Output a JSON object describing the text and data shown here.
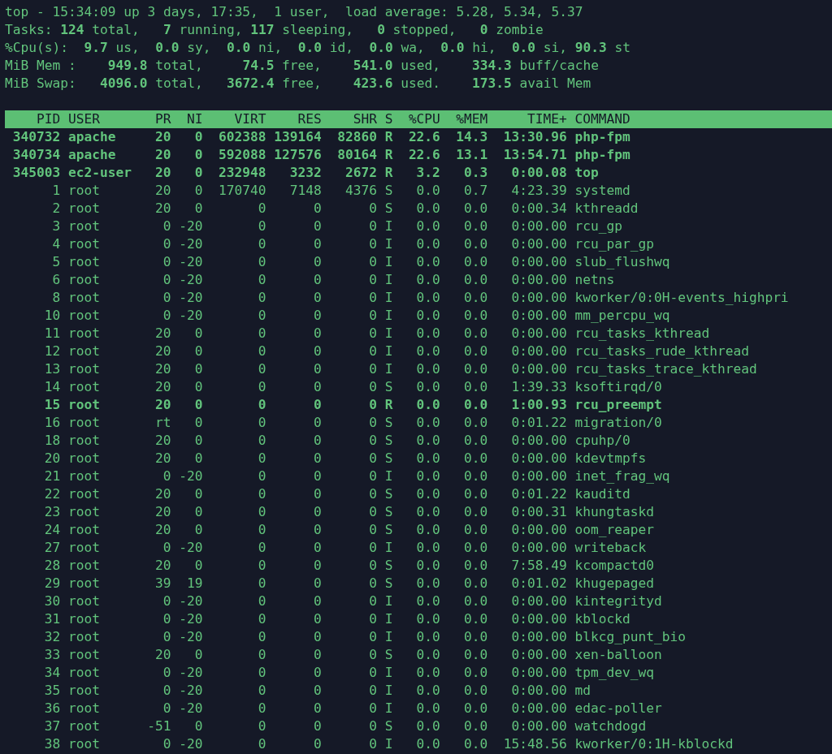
{
  "summary": [
    "top - 15:34:09 up 3 days, 17:35,  1 user,  load average: 5.28, 5.34, 5.37",
    "Tasks: **124** total,   **7** running, **117** sleeping,   **0** stopped,   **0** zombie",
    "%Cpu(s):  **9.7** us,  **0.0** sy,  **0.0** ni,  **0.0** id,  **0.0** wa,  **0.0** hi,  **0.0** si, **90.3** st",
    "MiB Mem :    **949.8** total,     **74.5** free,    **541.0** used,    **334.3** buff/cache",
    "MiB Swap:   **4096.0** total,   **3672.4** free,    **423.6** used.    **173.5** avail Mem"
  ],
  "table": {
    "columns": [
      "PID",
      "USER",
      "PR",
      "NI",
      "VIRT",
      "RES",
      "SHR",
      "S",
      "%CPU",
      "%MEM",
      "TIME+",
      "COMMAND"
    ],
    "rows": [
      {
        "highlighted": true,
        "cells": [
          "340732",
          "apache",
          "20",
          "0",
          "602388",
          "139164",
          "82860",
          "R",
          "22.6",
          "14.3",
          "13:30.96",
          "php-fpm"
        ]
      },
      {
        "highlighted": true,
        "cells": [
          "340734",
          "apache",
          "20",
          "0",
          "592088",
          "127576",
          "80164",
          "R",
          "22.6",
          "13.1",
          "13:54.71",
          "php-fpm"
        ]
      },
      {
        "highlighted": true,
        "cells": [
          "345003",
          "ec2-user",
          "20",
          "0",
          "232948",
          "3232",
          "2672",
          "R",
          "3.2",
          "0.3",
          "0:00.08",
          "top"
        ]
      },
      {
        "highlighted": false,
        "cells": [
          "1",
          "root",
          "20",
          "0",
          "170740",
          "7148",
          "4376",
          "S",
          "0.0",
          "0.7",
          "4:23.39",
          "systemd"
        ]
      },
      {
        "highlighted": false,
        "cells": [
          "2",
          "root",
          "20",
          "0",
          "0",
          "0",
          "0",
          "S",
          "0.0",
          "0.0",
          "0:00.34",
          "kthreadd"
        ]
      },
      {
        "highlighted": false,
        "cells": [
          "3",
          "root",
          "0",
          "-20",
          "0",
          "0",
          "0",
          "I",
          "0.0",
          "0.0",
          "0:00.00",
          "rcu_gp"
        ]
      },
      {
        "highlighted": false,
        "cells": [
          "4",
          "root",
          "0",
          "-20",
          "0",
          "0",
          "0",
          "I",
          "0.0",
          "0.0",
          "0:00.00",
          "rcu_par_gp"
        ]
      },
      {
        "highlighted": false,
        "cells": [
          "5",
          "root",
          "0",
          "-20",
          "0",
          "0",
          "0",
          "I",
          "0.0",
          "0.0",
          "0:00.00",
          "slub_flushwq"
        ]
      },
      {
        "highlighted": false,
        "cells": [
          "6",
          "root",
          "0",
          "-20",
          "0",
          "0",
          "0",
          "I",
          "0.0",
          "0.0",
          "0:00.00",
          "netns"
        ]
      },
      {
        "highlighted": false,
        "cells": [
          "8",
          "root",
          "0",
          "-20",
          "0",
          "0",
          "0",
          "I",
          "0.0",
          "0.0",
          "0:00.00",
          "kworker/0:0H-events_highpri"
        ]
      },
      {
        "highlighted": false,
        "cells": [
          "10",
          "root",
          "0",
          "-20",
          "0",
          "0",
          "0",
          "I",
          "0.0",
          "0.0",
          "0:00.00",
          "mm_percpu_wq"
        ]
      },
      {
        "highlighted": false,
        "cells": [
          "11",
          "root",
          "20",
          "0",
          "0",
          "0",
          "0",
          "I",
          "0.0",
          "0.0",
          "0:00.00",
          "rcu_tasks_kthread"
        ]
      },
      {
        "highlighted": false,
        "cells": [
          "12",
          "root",
          "20",
          "0",
          "0",
          "0",
          "0",
          "I",
          "0.0",
          "0.0",
          "0:00.00",
          "rcu_tasks_rude_kthread"
        ]
      },
      {
        "highlighted": false,
        "cells": [
          "13",
          "root",
          "20",
          "0",
          "0",
          "0",
          "0",
          "I",
          "0.0",
          "0.0",
          "0:00.00",
          "rcu_tasks_trace_kthread"
        ]
      },
      {
        "highlighted": false,
        "cells": [
          "14",
          "root",
          "20",
          "0",
          "0",
          "0",
          "0",
          "S",
          "0.0",
          "0.0",
          "1:39.33",
          "ksoftirqd/0"
        ]
      },
      {
        "highlighted": true,
        "cells": [
          "15",
          "root",
          "20",
          "0",
          "0",
          "0",
          "0",
          "R",
          "0.0",
          "0.0",
          "1:00.93",
          "rcu_preempt"
        ]
      },
      {
        "highlighted": false,
        "cells": [
          "16",
          "root",
          "rt",
          "0",
          "0",
          "0",
          "0",
          "S",
          "0.0",
          "0.0",
          "0:01.22",
          "migration/0"
        ]
      },
      {
        "highlighted": false,
        "cells": [
          "18",
          "root",
          "20",
          "0",
          "0",
          "0",
          "0",
          "S",
          "0.0",
          "0.0",
          "0:00.00",
          "cpuhp/0"
        ]
      },
      {
        "highlighted": false,
        "cells": [
          "20",
          "root",
          "20",
          "0",
          "0",
          "0",
          "0",
          "S",
          "0.0",
          "0.0",
          "0:00.00",
          "kdevtmpfs"
        ]
      },
      {
        "highlighted": false,
        "cells": [
          "21",
          "root",
          "0",
          "-20",
          "0",
          "0",
          "0",
          "I",
          "0.0",
          "0.0",
          "0:00.00",
          "inet_frag_wq"
        ]
      },
      {
        "highlighted": false,
        "cells": [
          "22",
          "root",
          "20",
          "0",
          "0",
          "0",
          "0",
          "S",
          "0.0",
          "0.0",
          "0:01.22",
          "kauditd"
        ]
      },
      {
        "highlighted": false,
        "cells": [
          "23",
          "root",
          "20",
          "0",
          "0",
          "0",
          "0",
          "S",
          "0.0",
          "0.0",
          "0:00.31",
          "khungtaskd"
        ]
      },
      {
        "highlighted": false,
        "cells": [
          "24",
          "root",
          "20",
          "0",
          "0",
          "0",
          "0",
          "S",
          "0.0",
          "0.0",
          "0:00.00",
          "oom_reaper"
        ]
      },
      {
        "highlighted": false,
        "cells": [
          "27",
          "root",
          "0",
          "-20",
          "0",
          "0",
          "0",
          "I",
          "0.0",
          "0.0",
          "0:00.00",
          "writeback"
        ]
      },
      {
        "highlighted": false,
        "cells": [
          "28",
          "root",
          "20",
          "0",
          "0",
          "0",
          "0",
          "S",
          "0.0",
          "0.0",
          "7:58.49",
          "kcompactd0"
        ]
      },
      {
        "highlighted": false,
        "cells": [
          "29",
          "root",
          "39",
          "19",
          "0",
          "0",
          "0",
          "S",
          "0.0",
          "0.0",
          "0:01.02",
          "khugepaged"
        ]
      },
      {
        "highlighted": false,
        "cells": [
          "30",
          "root",
          "0",
          "-20",
          "0",
          "0",
          "0",
          "I",
          "0.0",
          "0.0",
          "0:00.00",
          "kintegrityd"
        ]
      },
      {
        "highlighted": false,
        "cells": [
          "31",
          "root",
          "0",
          "-20",
          "0",
          "0",
          "0",
          "I",
          "0.0",
          "0.0",
          "0:00.00",
          "kblockd"
        ]
      },
      {
        "highlighted": false,
        "cells": [
          "32",
          "root",
          "0",
          "-20",
          "0",
          "0",
          "0",
          "I",
          "0.0",
          "0.0",
          "0:00.00",
          "blkcg_punt_bio"
        ]
      },
      {
        "highlighted": false,
        "cells": [
          "33",
          "root",
          "20",
          "0",
          "0",
          "0",
          "0",
          "S",
          "0.0",
          "0.0",
          "0:00.00",
          "xen-balloon"
        ]
      },
      {
        "highlighted": false,
        "cells": [
          "34",
          "root",
          "0",
          "-20",
          "0",
          "0",
          "0",
          "I",
          "0.0",
          "0.0",
          "0:00.00",
          "tpm_dev_wq"
        ]
      },
      {
        "highlighted": false,
        "cells": [
          "35",
          "root",
          "0",
          "-20",
          "0",
          "0",
          "0",
          "I",
          "0.0",
          "0.0",
          "0:00.00",
          "md"
        ]
      },
      {
        "highlighted": false,
        "cells": [
          "36",
          "root",
          "0",
          "-20",
          "0",
          "0",
          "0",
          "I",
          "0.0",
          "0.0",
          "0:00.00",
          "edac-poller"
        ]
      },
      {
        "highlighted": false,
        "cells": [
          "37",
          "root",
          "-51",
          "0",
          "0",
          "0",
          "0",
          "S",
          "0.0",
          "0.0",
          "0:00.00",
          "watchdogd"
        ]
      },
      {
        "highlighted": false,
        "cells": [
          "38",
          "root",
          "0",
          "-20",
          "0",
          "0",
          "0",
          "I",
          "0.0",
          "0.0",
          "15:48.56",
          "kworker/0:1H-kblockd"
        ]
      }
    ]
  }
}
